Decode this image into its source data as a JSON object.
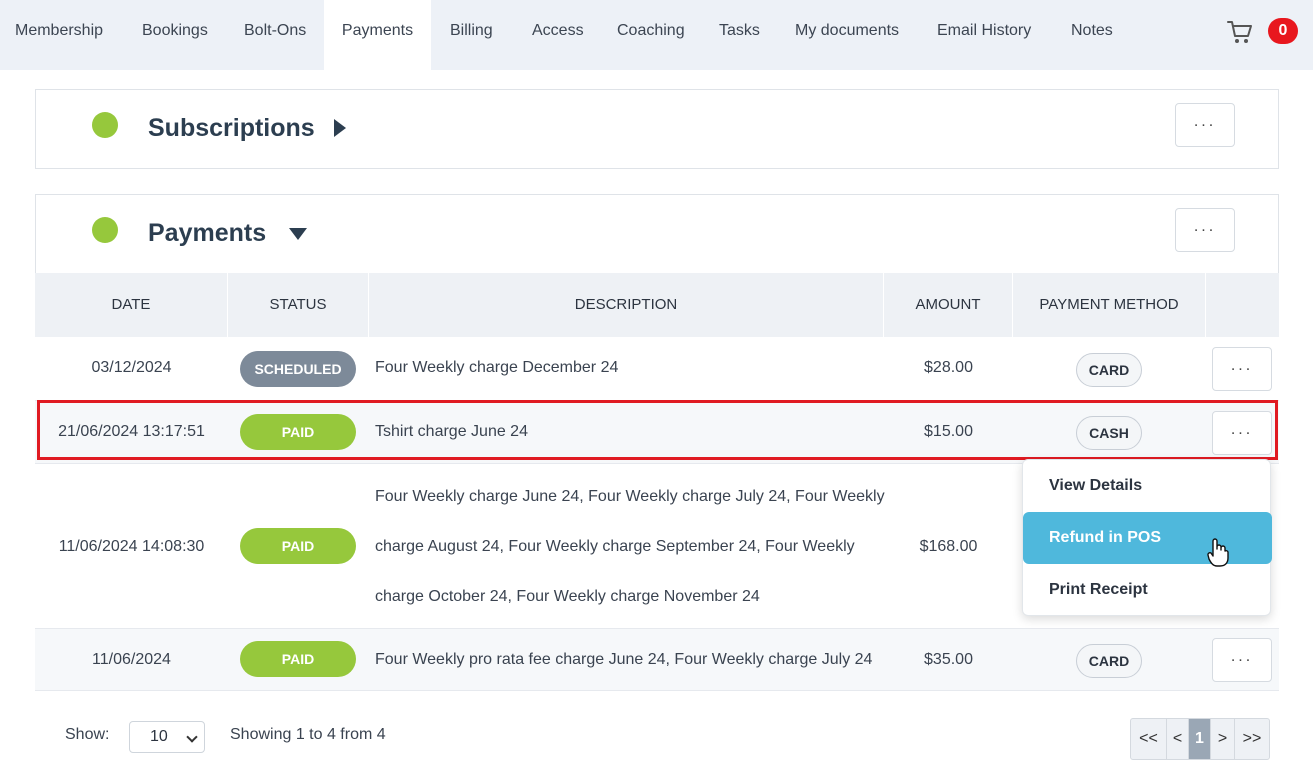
{
  "nav": {
    "tabs": [
      "Membership",
      "Bookings",
      "Bolt-Ons",
      "Payments",
      "Billing",
      "Access",
      "Coaching",
      "Tasks",
      "My documents",
      "Email History",
      "Notes"
    ],
    "active_tab": "Payments",
    "cart_count": "0"
  },
  "subscriptions": {
    "title": "Subscriptions",
    "more_label": "..."
  },
  "payments": {
    "title": "Payments",
    "more_label": "...",
    "columns": [
      "DATE",
      "STATUS",
      "DESCRIPTION",
      "AMOUNT",
      "PAYMENT METHOD"
    ],
    "rows": [
      {
        "date": "03/12/2024",
        "status": "SCHEDULED",
        "description": "Four Weekly charge December 24",
        "amount": "$28.00",
        "method": "CARD"
      },
      {
        "date": "21/06/2024 13:17:51",
        "status": "PAID",
        "description": "Tshirt charge June 24",
        "amount": "$15.00",
        "method": "CASH"
      },
      {
        "date": "11/06/2024 14:08:30",
        "status": "PAID",
        "description_lines": [
          "Four Weekly charge June 24, Four Weekly charge July 24, Four Weekly",
          "charge August 24, Four Weekly charge September 24, Four Weekly",
          "charge October 24, Four Weekly charge November 24"
        ],
        "amount": "$168.00",
        "method": ""
      },
      {
        "date": "11/06/2024",
        "status": "PAID",
        "description": "Four Weekly pro rata fee charge June 24, Four Weekly charge July 24",
        "amount": "$35.00",
        "method": "CARD"
      }
    ],
    "row_more_label": "..."
  },
  "context_menu": {
    "items": [
      "View Details",
      "Refund in POS",
      "Print Receipt"
    ],
    "hovered": "Refund in POS"
  },
  "footer": {
    "show_label": "Show:",
    "page_size": "10",
    "showing_text": "Showing 1 to 4 from 4",
    "pager": [
      "<<",
      "<",
      "1",
      ">",
      ">>"
    ]
  },
  "colors": {
    "paid": "#96c83c",
    "scheduled": "#7d8a99",
    "menu_hover": "#4fb8dc",
    "highlight": "#e01a22",
    "badge": "#e8171e"
  }
}
